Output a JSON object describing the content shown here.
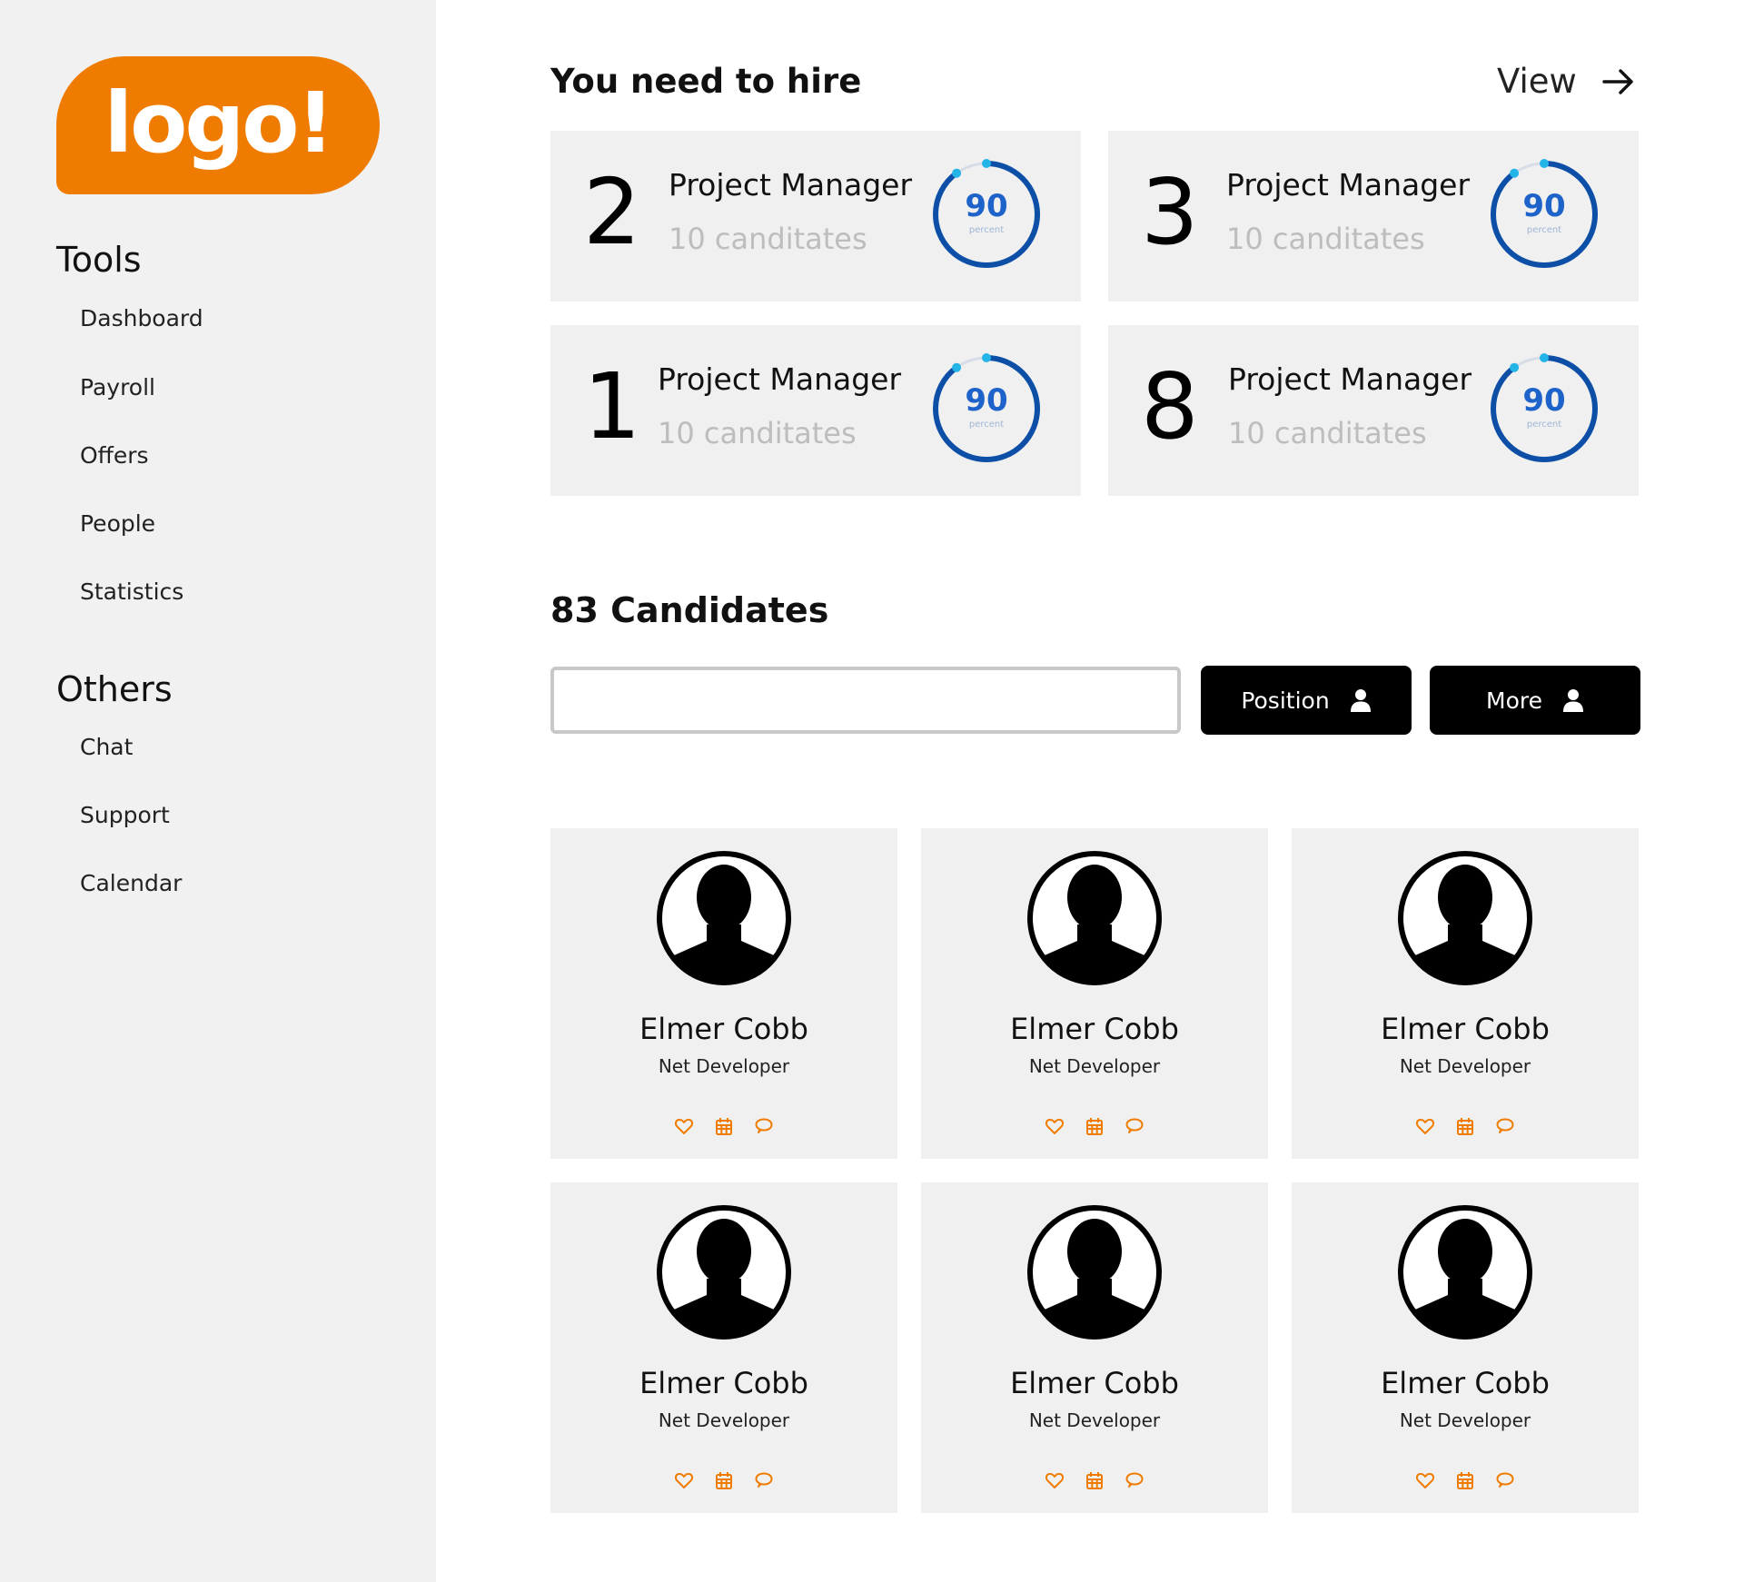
{
  "brand": {
    "logo_text": "logo!",
    "accent": "#ef7c00"
  },
  "sidebar": {
    "tools_title": "Tools",
    "tools": [
      "Dashboard",
      "Payroll",
      "Offers",
      "People",
      "Statistics"
    ],
    "others_title": "Others",
    "others": [
      "Chat",
      "Support",
      "Calendar"
    ]
  },
  "hire": {
    "title": "You need to hire",
    "view_label": "View",
    "view_icon": "arrow-right-icon",
    "cards": [
      {
        "count": "2",
        "role": "Project Manager",
        "candidates": "10 canditates",
        "percent": "90",
        "unit": "percent"
      },
      {
        "count": "3",
        "role": "Project Manager",
        "candidates": "10 canditates",
        "percent": "90",
        "unit": "percent"
      },
      {
        "count": "1",
        "role": "Project Manager",
        "candidates": "10 canditates",
        "percent": "90",
        "unit": "percent"
      },
      {
        "count": "8",
        "role": "Project Manager",
        "candidates": "10 canditates",
        "percent": "90",
        "unit": "percent"
      }
    ],
    "ring_color": "#1e63c9"
  },
  "candidates": {
    "title": "83 Candidates",
    "search_value": "",
    "position_label": "Position",
    "more_label": "More",
    "button_icon": "user-icon",
    "people": [
      {
        "name": "Elmer Cobb",
        "role": "Net Developer"
      },
      {
        "name": "Elmer Cobb",
        "role": "Net Developer"
      },
      {
        "name": "Elmer Cobb",
        "role": "Net Developer"
      },
      {
        "name": "Elmer Cobb",
        "role": "Net Developer"
      },
      {
        "name": "Elmer Cobb",
        "role": "Net Developer"
      },
      {
        "name": "Elmer Cobb",
        "role": "Net Developer"
      }
    ],
    "action_icons": [
      "heart-icon",
      "calendar-icon",
      "chat-bubble-icon"
    ]
  }
}
